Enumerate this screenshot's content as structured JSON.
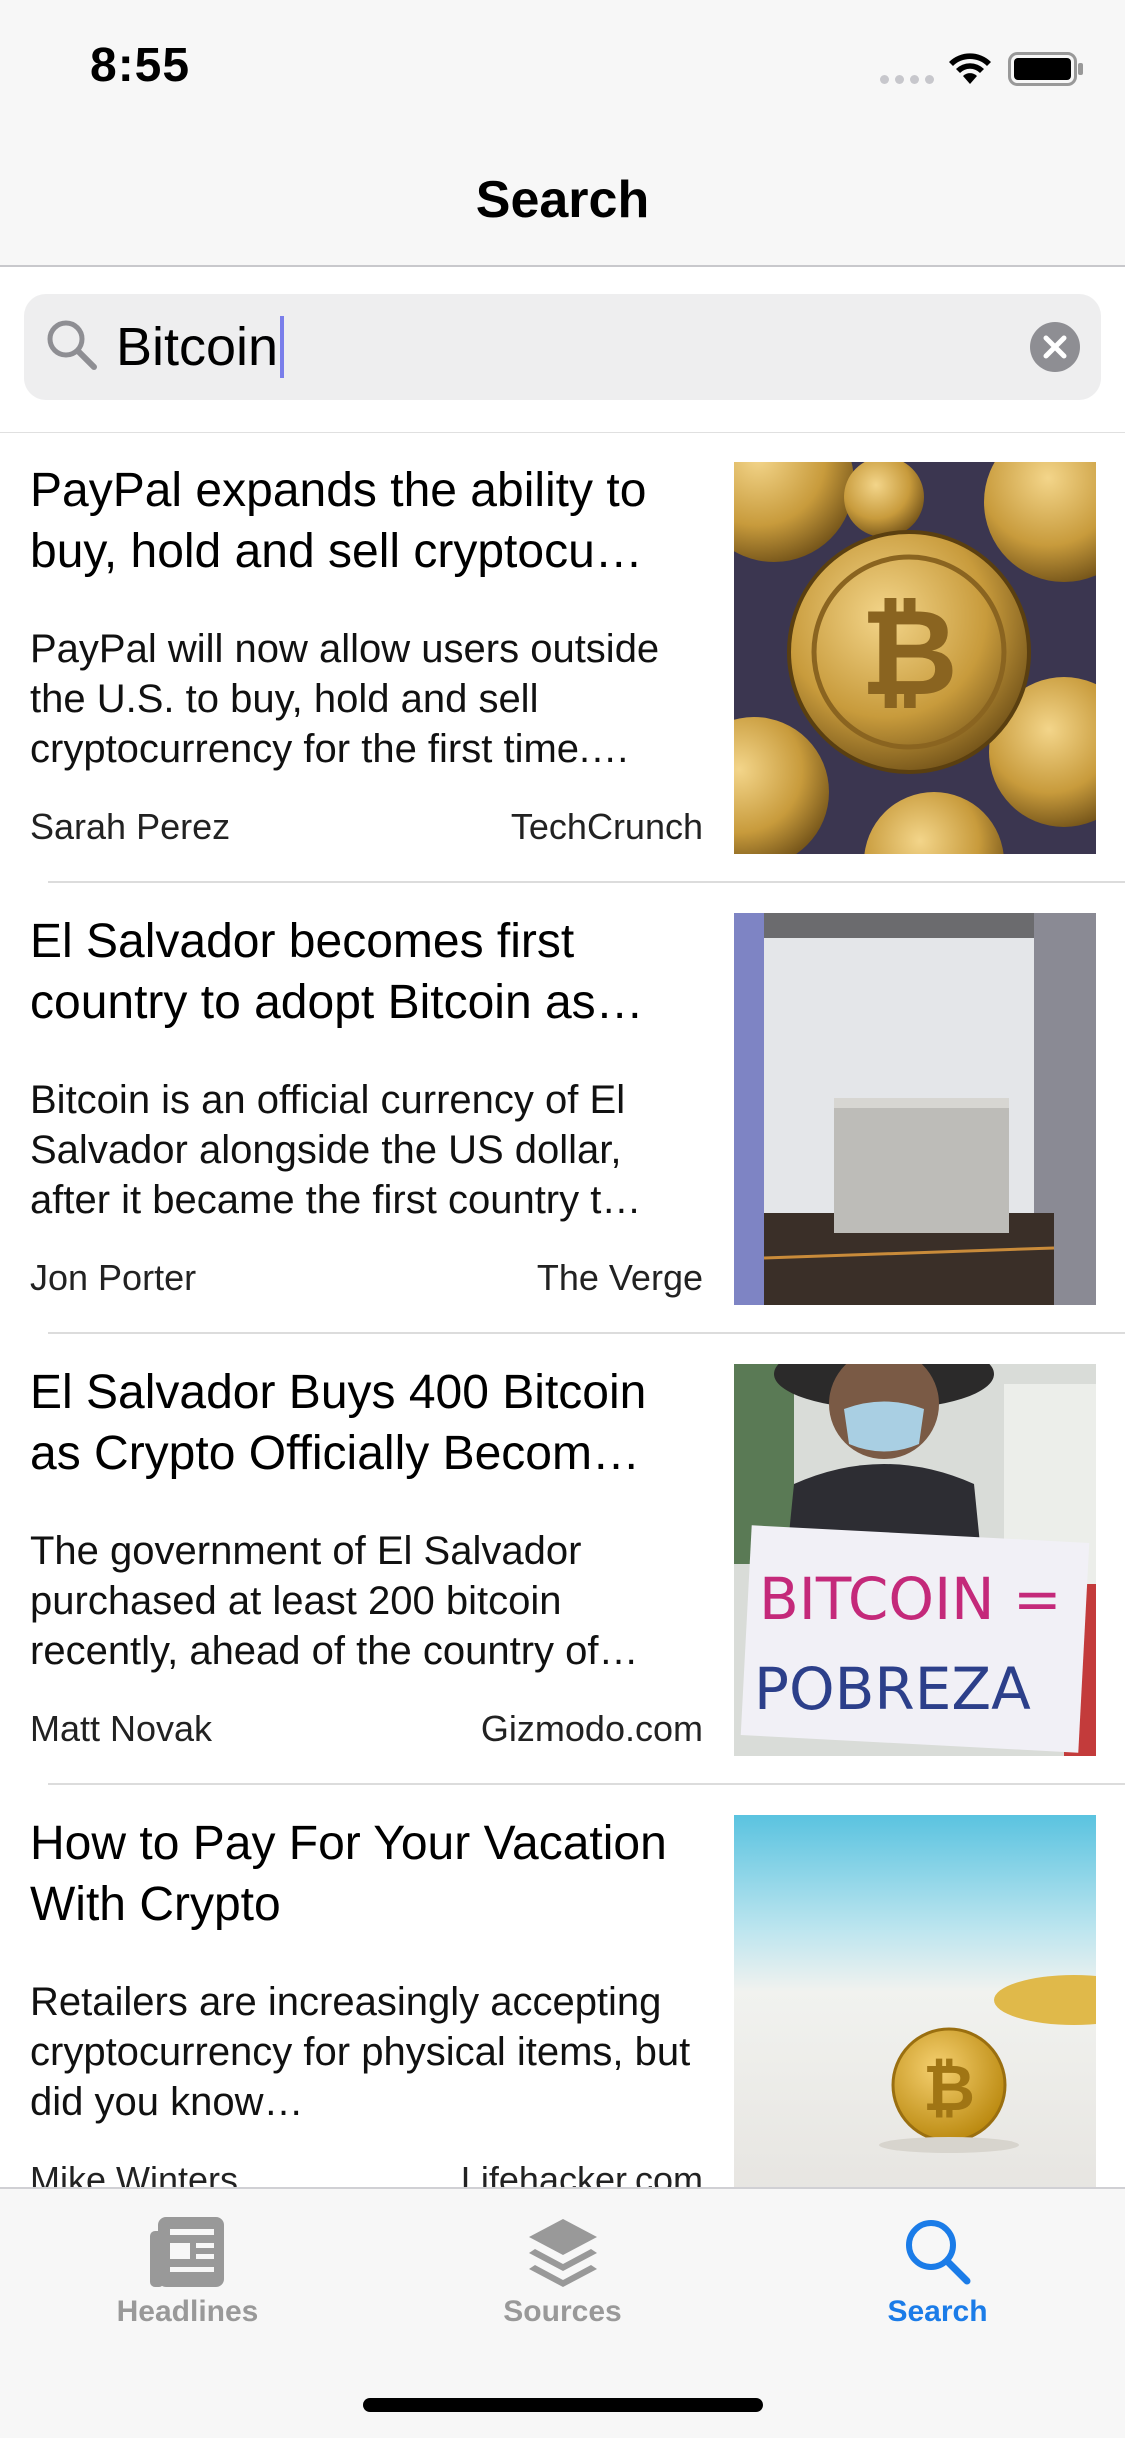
{
  "status_bar": {
    "time": "8:55"
  },
  "nav": {
    "title": "Search"
  },
  "search": {
    "query": "Bitcoin"
  },
  "articles": [
    {
      "title": "PayPal expands the ability to buy, hold and sell cryptocu…",
      "description": "PayPal will now allow users outside the U.S. to buy, hold and sell cryptocurrency for the first time.…",
      "author": "Sarah Perez",
      "source": "TechCrunch",
      "image": "bitcoin-coins-photo"
    },
    {
      "title": "El Salvador becomes first country to adopt Bitcoin as…",
      "description": "Bitcoin is an official currency of El Salvador alongside the US dollar, after it became the first country t…",
      "author": "Jon Porter",
      "source": "The Verge",
      "image": "empty-room-photo"
    },
    {
      "title": "El Salvador Buys 400 Bitcoin as Crypto Officially Becom…",
      "description": "The government of El Salvador purchased at least 200 bitcoin recently, ahead of the country of…",
      "author": "Matt Novak",
      "source": "Gizmodo.com",
      "image": "protest-sign-photo",
      "image_sign_line1": "BITCOIN =",
      "image_sign_line2": "POBREZA"
    },
    {
      "title": "How to Pay For Your Vacation With Crypto",
      "description": "Retailers are increasingly accepting cryptocurrency for physical items, but did you know…",
      "author": "Mike Winters",
      "source": "Lifehacker.com",
      "image": "coin-on-beach-photo"
    }
  ],
  "tabs": [
    {
      "label": "Headlines",
      "icon": "newspaper-icon",
      "active": false
    },
    {
      "label": "Sources",
      "icon": "layers-icon",
      "active": false
    },
    {
      "label": "Search",
      "icon": "search-icon",
      "active": true
    }
  ],
  "colors": {
    "accent": "#1b7ce8",
    "inactive": "#999999",
    "caret": "#7a7eea"
  }
}
